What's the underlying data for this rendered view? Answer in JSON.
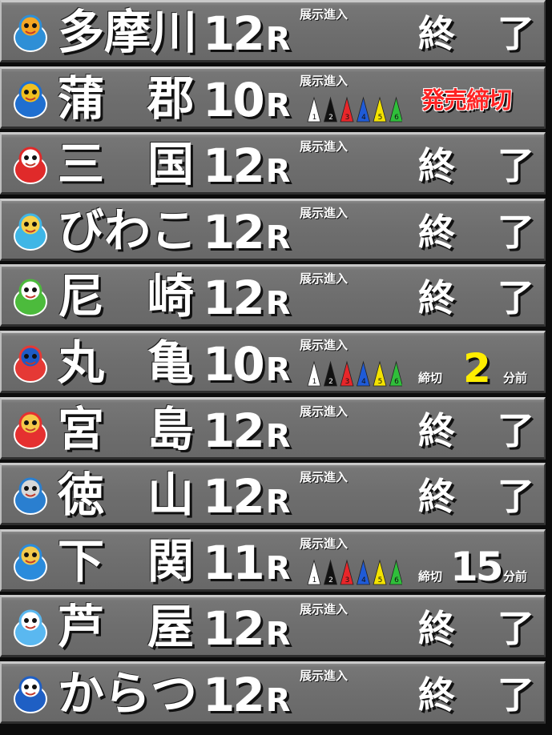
{
  "race_label_suffix": "R",
  "exhibition_label": "展示進入",
  "colors": {
    "row_bg": "#707070",
    "text": "#ffffff",
    "sale_closed": "#ff2323",
    "countdown_highlight": "#ffee00",
    "cones": [
      "#ffffff",
      "#111111",
      "#e8262a",
      "#1f5bd8",
      "#f4e300",
      "#2fbf3a"
    ]
  },
  "cone_numbers": [
    "1",
    "2",
    "3",
    "4",
    "5",
    "6"
  ],
  "venues": [
    {
      "name": [
        "多",
        "摩",
        "川"
      ],
      "race": "12",
      "mascot_icon": "bird-mascot-icon",
      "status_type": "ended",
      "status": [
        "終",
        "了"
      ]
    },
    {
      "name": [
        "蒲",
        "郡"
      ],
      "race": "10",
      "mascot_icon": "boat-mascot-icon",
      "status_type": "closed",
      "status_text": "発売締切",
      "cones": true
    },
    {
      "name": [
        "三",
        "国"
      ],
      "race": "12",
      "mascot_icon": "crab-mascot-icon",
      "status_type": "ended",
      "status": [
        "終",
        "了"
      ]
    },
    {
      "name": [
        "び",
        "わ",
        "こ"
      ],
      "race": "12",
      "mascot_icon": "catfish-mascot-icon",
      "status_type": "ended",
      "status": [
        "終",
        "了"
      ]
    },
    {
      "name": [
        "尼",
        "崎"
      ],
      "race": "12",
      "mascot_icon": "frog-mascot-icon",
      "status_type": "ended",
      "status": [
        "終",
        "了"
      ]
    },
    {
      "name": [
        "丸",
        "亀"
      ],
      "race": "10",
      "mascot_icon": "turtle-mascot-icon",
      "status_type": "countdown",
      "countdown_label": "締切",
      "countdown_value": "2",
      "countdown_unit": "分前",
      "highlight": true,
      "cones": true
    },
    {
      "name": [
        "宮",
        "島"
      ],
      "race": "12",
      "mascot_icon": "boy-mascot-icon",
      "status_type": "ended",
      "status": [
        "終",
        "了"
      ]
    },
    {
      "name": [
        "徳",
        "山"
      ],
      "race": "12",
      "mascot_icon": "dolphin-mascot-icon",
      "status_type": "ended",
      "status": [
        "終",
        "了"
      ]
    },
    {
      "name": [
        "下",
        "関"
      ],
      "race": "11",
      "mascot_icon": "racer-mascot-icon",
      "status_type": "countdown",
      "countdown_label": "締切",
      "countdown_value": "15",
      "countdown_unit": "分前",
      "highlight": false,
      "cones": true
    },
    {
      "name": [
        "芦",
        "屋"
      ],
      "race": "12",
      "mascot_icon": "bird-party-mascot-icon",
      "status_type": "ended",
      "status": [
        "終",
        "了"
      ]
    },
    {
      "name": [
        "か",
        "ら",
        "つ"
      ],
      "race": "12",
      "mascot_icon": "dolphin-blue-mascot-icon",
      "status_type": "ended",
      "status": [
        "終",
        "了"
      ]
    }
  ]
}
